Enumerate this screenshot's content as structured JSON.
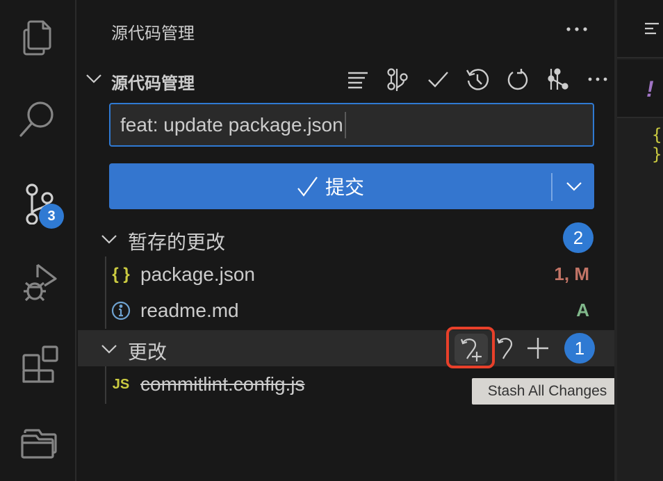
{
  "activity_bar": {
    "items": [
      {
        "name": "explorer",
        "icon": "files-icon"
      },
      {
        "name": "search",
        "icon": "search-icon"
      },
      {
        "name": "source-control",
        "icon": "source-control-icon",
        "badge": "3"
      },
      {
        "name": "run-debug",
        "icon": "debug-icon"
      },
      {
        "name": "extensions",
        "icon": "extensions-icon"
      },
      {
        "name": "folders",
        "icon": "folder-icon"
      }
    ]
  },
  "sidebar": {
    "title": "源代码管理",
    "more_icon": "ellipsis-icon",
    "repo": {
      "title": "源代码管理",
      "actions": [
        {
          "name": "view-as-list",
          "icon": "list-flat-icon"
        },
        {
          "name": "graph",
          "icon": "git-graph-icon"
        },
        {
          "name": "commit",
          "icon": "check-icon"
        },
        {
          "name": "history",
          "icon": "history-icon"
        },
        {
          "name": "refresh",
          "icon": "refresh-icon"
        },
        {
          "name": "branches",
          "icon": "git-compare-icon"
        },
        {
          "name": "more",
          "icon": "ellipsis-icon"
        }
      ]
    },
    "commit_message": {
      "value": "feat: update package.json"
    },
    "commit_button": {
      "label": "提交",
      "icon": "check-icon"
    },
    "staged": {
      "label": "暂存的更改",
      "count": "2",
      "files": [
        {
          "name": "package.json",
          "icon": "json-icon",
          "icon_text": "{ }",
          "status": "1, M",
          "status_color": "#c27466"
        },
        {
          "name": "readme.md",
          "icon": "info-icon",
          "status": "A",
          "status_color": "#81b88b"
        }
      ]
    },
    "changes": {
      "label": "更改",
      "count": "1",
      "actions": [
        {
          "name": "stash-all-changes",
          "icon": "stash-icon"
        },
        {
          "name": "discard-all-changes",
          "icon": "discard-icon"
        },
        {
          "name": "stage-all-changes",
          "icon": "plus-icon"
        }
      ],
      "files": [
        {
          "name": "commitlint.config.js",
          "icon": "js-icon",
          "icon_text": "JS",
          "status": "",
          "deleted": true
        }
      ]
    }
  },
  "tooltip": {
    "text": "Stash All Changes"
  },
  "editor": {
    "tab_icon": "outline-icon",
    "warn_glyph": "!",
    "brace_glyph": "{ }"
  },
  "colors": {
    "accent": "#2f7ad3",
    "button": "#3476cf",
    "highlight": "#e8402a",
    "modified": "#c27466",
    "added": "#81b88b",
    "json": "#cbcb41",
    "info": "#6fa3d1"
  }
}
